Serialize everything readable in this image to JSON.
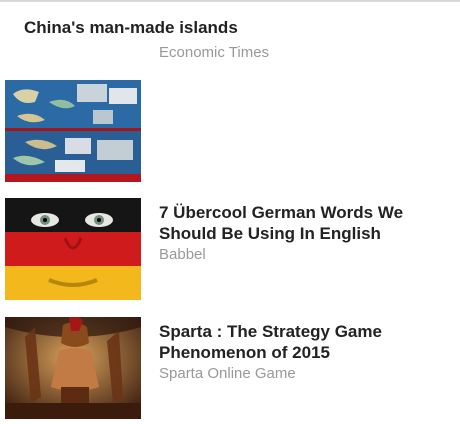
{
  "feed": {
    "items": [
      {
        "title": "China's man-made islands",
        "source": "Economic Times"
      },
      {
        "title": "",
        "source": ""
      },
      {
        "title": "7 Übercool German Words We Should Be Using In English",
        "source": "Babbel"
      },
      {
        "title": "Sparta : The Strategy Game Phenomenon of 2015",
        "source": "Sparta Online Game"
      }
    ]
  }
}
